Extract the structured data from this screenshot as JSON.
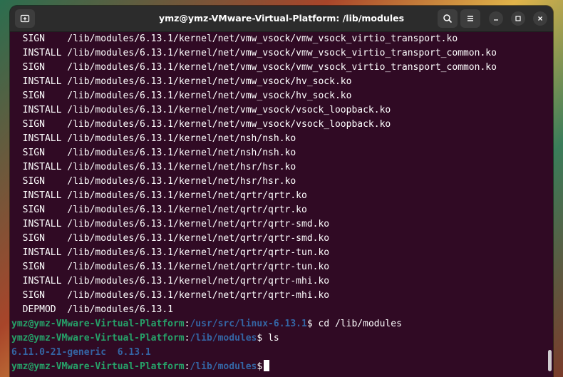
{
  "window": {
    "title": "ymz@ymz-VMware-Virtual-Platform: /lib/modules"
  },
  "titlebar_buttons": [
    {
      "name": "new-tab-icon"
    },
    {
      "name": "search-icon"
    },
    {
      "name": "hamburger-menu-icon"
    },
    {
      "name": "minimize-icon"
    },
    {
      "name": "maximize-icon"
    },
    {
      "name": "close-icon"
    }
  ],
  "output_lines": [
    {
      "action": "SIGN",
      "path": "/lib/modules/6.13.1/kernel/net/vmw_vsock/vmw_vsock_virtio_transport.ko"
    },
    {
      "action": "INSTALL",
      "path": "/lib/modules/6.13.1/kernel/net/vmw_vsock/vmw_vsock_virtio_transport_common.ko"
    },
    {
      "action": "SIGN",
      "path": "/lib/modules/6.13.1/kernel/net/vmw_vsock/vmw_vsock_virtio_transport_common.ko"
    },
    {
      "action": "INSTALL",
      "path": "/lib/modules/6.13.1/kernel/net/vmw_vsock/hv_sock.ko"
    },
    {
      "action": "SIGN",
      "path": "/lib/modules/6.13.1/kernel/net/vmw_vsock/hv_sock.ko"
    },
    {
      "action": "INSTALL",
      "path": "/lib/modules/6.13.1/kernel/net/vmw_vsock/vsock_loopback.ko"
    },
    {
      "action": "SIGN",
      "path": "/lib/modules/6.13.1/kernel/net/vmw_vsock/vsock_loopback.ko"
    },
    {
      "action": "INSTALL",
      "path": "/lib/modules/6.13.1/kernel/net/nsh/nsh.ko"
    },
    {
      "action": "SIGN",
      "path": "/lib/modules/6.13.1/kernel/net/nsh/nsh.ko"
    },
    {
      "action": "INSTALL",
      "path": "/lib/modules/6.13.1/kernel/net/hsr/hsr.ko"
    },
    {
      "action": "SIGN",
      "path": "/lib/modules/6.13.1/kernel/net/hsr/hsr.ko"
    },
    {
      "action": "INSTALL",
      "path": "/lib/modules/6.13.1/kernel/net/qrtr/qrtr.ko"
    },
    {
      "action": "SIGN",
      "path": "/lib/modules/6.13.1/kernel/net/qrtr/qrtr.ko"
    },
    {
      "action": "INSTALL",
      "path": "/lib/modules/6.13.1/kernel/net/qrtr/qrtr-smd.ko"
    },
    {
      "action": "SIGN",
      "path": "/lib/modules/6.13.1/kernel/net/qrtr/qrtr-smd.ko"
    },
    {
      "action": "INSTALL",
      "path": "/lib/modules/6.13.1/kernel/net/qrtr/qrtr-tun.ko"
    },
    {
      "action": "SIGN",
      "path": "/lib/modules/6.13.1/kernel/net/qrtr/qrtr-tun.ko"
    },
    {
      "action": "INSTALL",
      "path": "/lib/modules/6.13.1/kernel/net/qrtr/qrtr-mhi.ko"
    },
    {
      "action": "SIGN",
      "path": "/lib/modules/6.13.1/kernel/net/qrtr/qrtr-mhi.ko"
    },
    {
      "action": "DEPMOD",
      "path": "/lib/modules/6.13.1"
    }
  ],
  "prompts": [
    {
      "user": "ymz@ymz-VMware-Virtual-Platform",
      "sep": ":",
      "cwd": "/usr/src/linux-6.13.1",
      "sym": "$",
      "cmd": " cd /lib/modules"
    },
    {
      "user": "ymz@ymz-VMware-Virtual-Platform",
      "sep": ":",
      "cwd": "/lib/modules",
      "sym": "$",
      "cmd": " ls"
    }
  ],
  "ls_output": [
    "6.11.0-21-generic",
    "6.13.1"
  ],
  "current_prompt": {
    "user": "ymz@ymz-VMware-Virtual-Platform",
    "sep": ":",
    "cwd": "/lib/modules",
    "sym": "$",
    "cmd": ""
  },
  "colors": {
    "background": "#300a24",
    "user": "#26a269",
    "path": "#3465a4",
    "text": "#ffffff"
  }
}
